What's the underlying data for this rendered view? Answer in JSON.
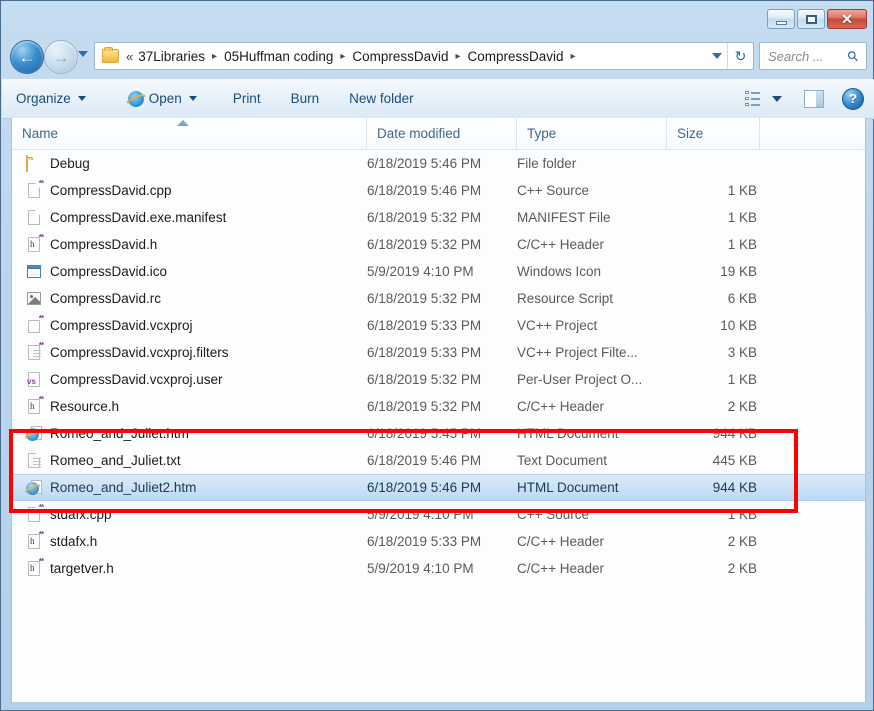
{
  "window": {
    "title": "",
    "controls": {
      "minimize": "Minimize",
      "maximize": "Maximize",
      "close": "✕"
    }
  },
  "nav": {
    "back_label": "←",
    "forward_label": "→",
    "recent_dropdown_label": "Recent pages",
    "breadcrumb_overflow": "«",
    "crumbs": [
      "37Libraries",
      "05Huffman coding",
      "CompressDavid",
      "CompressDavid"
    ],
    "separator": "▸",
    "address_dropdown_label": "Previous locations",
    "refresh_label": "↻"
  },
  "search": {
    "placeholder": "Search ...",
    "value": "",
    "icon": "search-icon"
  },
  "toolbar": {
    "organize": "Organize",
    "open": "Open",
    "print": "Print",
    "burn": "Burn",
    "new_folder": "New folder",
    "view_label": "Change your view",
    "preview_label": "Show the preview pane",
    "help_label": "?"
  },
  "columns": [
    {
      "key": "name",
      "label": "Name",
      "sorted": true,
      "sort_dir": "asc"
    },
    {
      "key": "date",
      "label": "Date modified"
    },
    {
      "key": "type",
      "label": "Type"
    },
    {
      "key": "size",
      "label": "Size"
    }
  ],
  "files": [
    {
      "name": "Debug",
      "date": "6/18/2019 5:46 PM",
      "type": "File folder",
      "size": "",
      "icon": "folder-icon",
      "selected": false
    },
    {
      "name": "CompressDavid.cpp",
      "date": "6/18/2019 5:46 PM",
      "type": "C++ Source",
      "size": "1 KB",
      "icon": "cpp-source-icon",
      "selected": false
    },
    {
      "name": "CompressDavid.exe.manifest",
      "date": "6/18/2019 5:32 PM",
      "type": "MANIFEST File",
      "size": "1 KB",
      "icon": "blank-file-icon",
      "selected": false
    },
    {
      "name": "CompressDavid.h",
      "date": "6/18/2019 5:32 PM",
      "type": "C/C++ Header",
      "size": "1 KB",
      "icon": "header-file-icon",
      "selected": false
    },
    {
      "name": "CompressDavid.ico",
      "date": "5/9/2019 4:10 PM",
      "type": "Windows Icon",
      "size": "19 KB",
      "icon": "windows-icon-file",
      "selected": false
    },
    {
      "name": "CompressDavid.rc",
      "date": "6/18/2019 5:32 PM",
      "type": "Resource Script",
      "size": "6 KB",
      "icon": "image-file-icon",
      "selected": false
    },
    {
      "name": "CompressDavid.vcxproj",
      "date": "6/18/2019 5:33 PM",
      "type": "VC++ Project",
      "size": "10 KB",
      "icon": "vcxproj-icon",
      "selected": false
    },
    {
      "name": "CompressDavid.vcxproj.filters",
      "date": "6/18/2019 5:33 PM",
      "type": "VC++ Project Filte...",
      "size": "3 KB",
      "icon": "vcxproj-filters-icon",
      "selected": false
    },
    {
      "name": "CompressDavid.vcxproj.user",
      "date": "6/18/2019 5:32 PM",
      "type": "Per-User Project O...",
      "size": "1 KB",
      "icon": "vcxproj-user-icon",
      "selected": false
    },
    {
      "name": "Resource.h",
      "date": "6/18/2019 5:32 PM",
      "type": "C/C++ Header",
      "size": "2 KB",
      "icon": "header-file-icon",
      "selected": false
    },
    {
      "name": "Romeo_and_Juliet.htm",
      "date": "6/18/2019 5:45 PM",
      "type": "HTML Document",
      "size": "944 KB",
      "icon": "html-file-icon",
      "selected": false
    },
    {
      "name": "Romeo_and_Juliet.txt",
      "date": "6/18/2019 5:46 PM",
      "type": "Text Document",
      "size": "445 KB",
      "icon": "text-file-icon",
      "selected": false
    },
    {
      "name": "Romeo_and_Juliet2.htm",
      "date": "6/18/2019 5:46 PM",
      "type": "HTML Document",
      "size": "944 KB",
      "icon": "html-file-icon",
      "selected": true
    },
    {
      "name": "stdafx.cpp",
      "date": "5/9/2019 4:10 PM",
      "type": "C++ Source",
      "size": "1 KB",
      "icon": "cpp-source-icon",
      "selected": false
    },
    {
      "name": "stdafx.h",
      "date": "6/18/2019 5:33 PM",
      "type": "C/C++ Header",
      "size": "2 KB",
      "icon": "header-file-icon",
      "selected": false
    },
    {
      "name": "targetver.h",
      "date": "5/9/2019 4:10 PM",
      "type": "C/C++ Header",
      "size": "2 KB",
      "icon": "header-file-icon",
      "selected": false
    }
  ],
  "annotation": {
    "color": "#ff0000",
    "highlights_rows": [
      "Romeo_and_Juliet.htm",
      "Romeo_and_Juliet.txt",
      "Romeo_and_Juliet2.htm"
    ]
  },
  "colors": {
    "accent": "#2e6ea8",
    "annotation_red": "#ff0000",
    "selection_blue": "#cbe2f8",
    "column_header_text": "#41678c"
  }
}
